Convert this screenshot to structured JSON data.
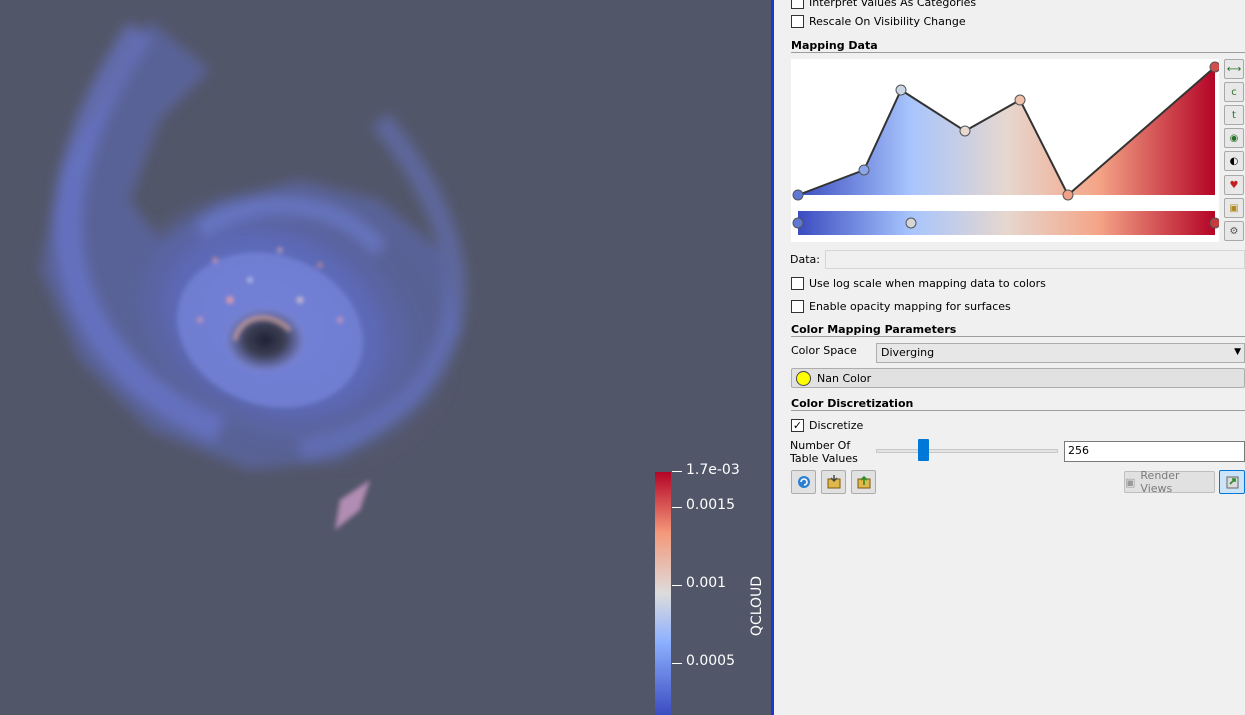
{
  "render_view": {
    "color_legend": {
      "title": "QCLOUD",
      "tick_labels": [
        "1.7e-03",
        "0.0015",
        "0.001",
        "0.0005"
      ],
      "colors": {
        "high": "#b40426",
        "mid": "#dddcdc",
        "low": "#3b4cc0"
      }
    },
    "background_color": "#525669"
  },
  "properties": {
    "interpret_categories": {
      "label": "Interpret Values As Categories",
      "checked": false
    },
    "rescale_visibility": {
      "label": "Rescale On Visibility Change",
      "checked": false
    },
    "mapping_data": {
      "title": "Mapping Data",
      "data_label": "Data:",
      "data_value": "",
      "log_scale": {
        "label": "Use log scale when mapping data to colors",
        "checked": false
      },
      "opacity_mapping": {
        "label": "Enable opacity mapping for surfaces",
        "checked": false
      },
      "side_buttons": [
        "rescale-range-icon",
        "rescale-custom-icon",
        "rescale-temporal-icon",
        "rescale-visible-icon",
        "invert-icon",
        "choose-preset-icon",
        "save-preset-icon",
        "advanced-gear-icon"
      ]
    },
    "color_mapping": {
      "title": "Color Mapping Parameters",
      "color_space_label": "Color Space",
      "color_space_value": "Diverging",
      "nan_color_label": "Nan Color",
      "nan_color": "#ffff00"
    },
    "discretization": {
      "title": "Color Discretization",
      "discretize": {
        "label": "Discretize",
        "checked": true
      },
      "table_values_label": "Number Of Table Values",
      "table_values": "256"
    },
    "render_views_label": "Render Views"
  }
}
